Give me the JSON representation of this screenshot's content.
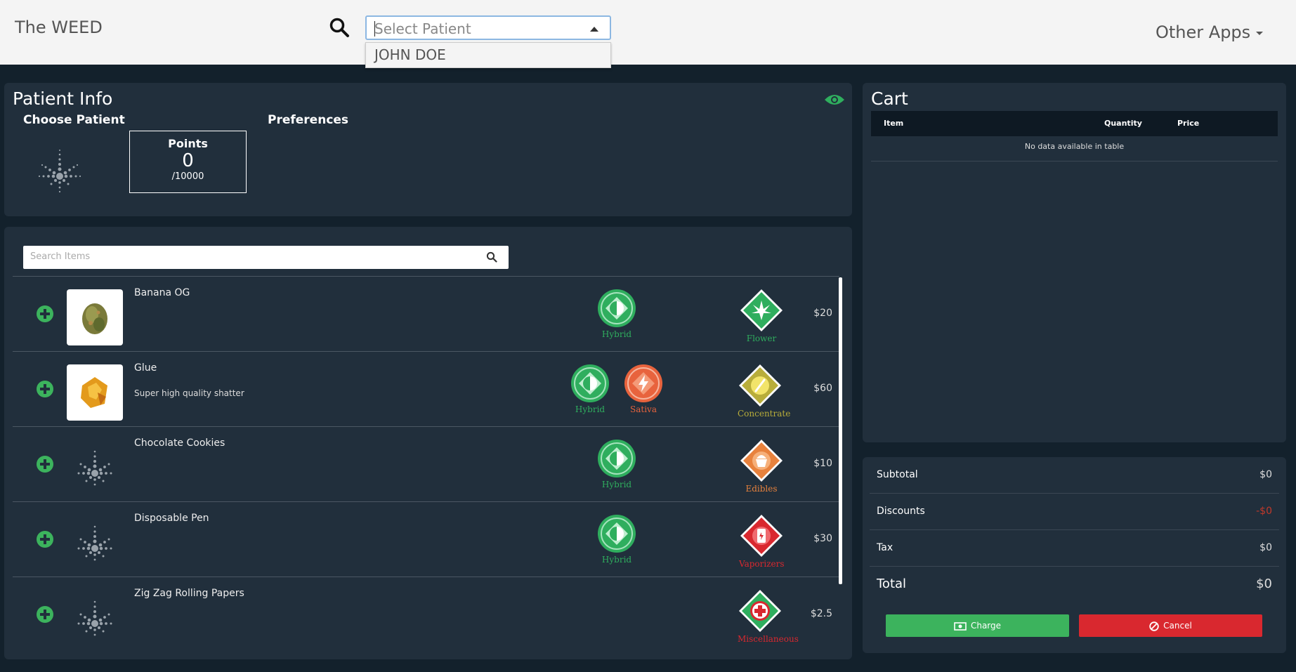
{
  "header": {
    "brand": "The WEED",
    "patient_select_placeholder": "Select Patient",
    "dropdown_options": [
      "JOHN DOE"
    ],
    "other_apps": "Other Apps"
  },
  "patient_info": {
    "title": "Patient Info",
    "choose_patient": "Choose Patient",
    "preferences": "Preferences",
    "points_label": "Points",
    "points_value": "0",
    "points_max": "/10000"
  },
  "items": {
    "search_placeholder": "Search Items",
    "list": [
      {
        "name": "Banana OG",
        "description": "",
        "strains": [
          "Hybrid"
        ],
        "category": "Flower",
        "price": "$20"
      },
      {
        "name": "Glue",
        "description": "Super high quality shatter",
        "strains": [
          "Hybrid",
          "Sativa"
        ],
        "category": "Concentrate",
        "price": "$60"
      },
      {
        "name": "Chocolate Cookies",
        "description": "",
        "strains": [
          "Hybrid"
        ],
        "category": "Edibles",
        "price": "$10"
      },
      {
        "name": "Disposable Pen",
        "description": "",
        "strains": [
          "Hybrid"
        ],
        "category": "Vaporizers",
        "price": "$30"
      },
      {
        "name": "Zig Zag Rolling Papers",
        "description": "",
        "strains": [],
        "category": "Miscellaneous",
        "price": "$2.5"
      }
    ]
  },
  "cart": {
    "title": "Cart",
    "columns": [
      "Item",
      "Quantity",
      "Price"
    ],
    "empty_text": "No data available in table"
  },
  "totals": {
    "subtotal_label": "Subtotal",
    "subtotal_value": "$0",
    "discounts_label": "Discounts",
    "discounts_value": "-$0",
    "tax_label": "Tax",
    "tax_value": "$0",
    "total_label": "Total",
    "total_value": "$0",
    "charge_label": "Charge",
    "cancel_label": "Cancel"
  },
  "colors": {
    "hybrid": "#2fae5e",
    "sativa": "#e8633d",
    "flower": "#2fae5e",
    "concentrate": "#b8ad3a",
    "edibles": "#e8823d",
    "vaporizers": "#d9282f",
    "miscellaneous": "#d9282f",
    "discount": "#c0392b"
  },
  "icons": [
    "search-icon",
    "eye-icon",
    "plus-circle-icon",
    "cannabis-leaf-placeholder-icon",
    "money-icon",
    "ban-icon"
  ]
}
